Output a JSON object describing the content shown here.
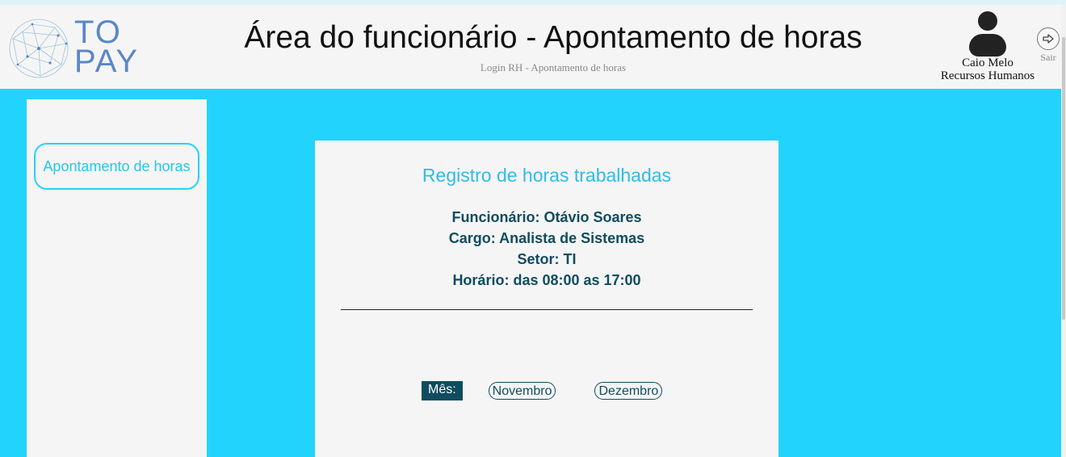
{
  "header": {
    "logo_line1": "TO",
    "logo_line2": "PAY",
    "title": "Área do funcionário - Apontamento de horas",
    "subtitle": "Login RH - Apontamento de horas",
    "user_name": "Caio Melo",
    "user_role": "Recursos Humanos",
    "logout_label": "Sair"
  },
  "sidebar": {
    "items": [
      {
        "label": "Apontamento de horas"
      }
    ]
  },
  "card": {
    "title": "Registro de horas trabalhadas",
    "employee": "Funcionário: Otávio Soares",
    "role": "Cargo: Analista de Sistemas",
    "sector": "Setor: TI",
    "schedule": "Horário: das 08:00 as 17:00",
    "month_label": "Mês:",
    "months": [
      "Novembro",
      "Dezembro"
    ]
  },
  "colors": {
    "accent": "#22d3fd",
    "panel": "#f5f5f5",
    "dark_teal": "#0f4c60",
    "logo_blue": "#5b87c6"
  },
  "icons": {
    "logo": "network-globe-icon",
    "avatar": "user-avatar-icon",
    "logout": "logout-arrow-icon"
  }
}
